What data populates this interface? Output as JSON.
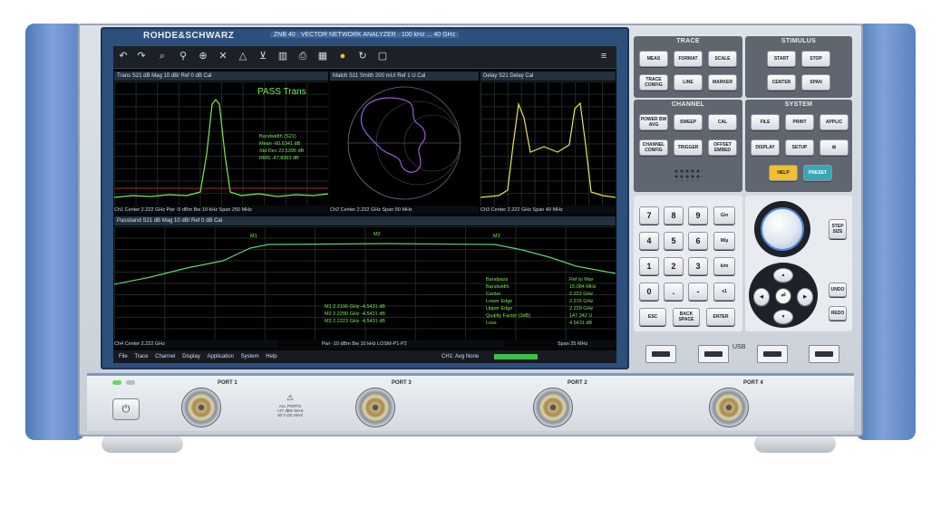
{
  "instrument": {
    "brand": "ROHDE&SCHWARZ",
    "model": "ZNB 40 · VECTOR NETWORK ANALYZER · 100 kHz ... 40 GHz"
  },
  "screen": {
    "toolbar_icons": [
      "undo-icon",
      "redo-icon",
      "zoom-icon",
      "zoom-out-icon",
      "marker-icon",
      "fit-icon",
      "peak-icon",
      "delta-icon",
      "trash-icon",
      "print-icon",
      "windows-icon",
      "help-icon",
      "refresh-icon",
      "display-icon",
      "menu-icon"
    ],
    "trace1": {
      "header": "Trans S21 dB Mag 10 dB/ Ref 0 dB Cal",
      "pass": "PASS Trans",
      "stats": [
        "Bandwidth (S21)",
        "Mean  -60.6341 dB",
        "Std Dev  23.5395 dB",
        "RMS  -47.8363 dB"
      ],
      "footer": "Ch1 Center 2.222 GHz Pwr -5 dBm Bw 10 kHz Span 250 MHz"
    },
    "trace2": {
      "header": "Match S11 Smith 200 mU/ Ref 1 U Cal",
      "footer": "Ch2 Center 2.222 GHz Span 50 MHz"
    },
    "trace3": {
      "header": "Delay S21 Delay Cal",
      "footer": "Ch3 Center 2.222 GHz Span 40 MHz"
    },
    "trace4": {
      "header": "Passband S21 dB Mag 10 dB/ Ref 0 dB Cal",
      "markers": [
        "M1",
        "M2",
        "M3"
      ],
      "readout": [
        "M1 2.2196 GHz -4.5431 dB",
        "M2 2.2290 GHz -4.5431 dB",
        "M3 2.2223 GHz -4.5431 dB"
      ],
      "bw_table": [
        [
          "Bandpass",
          "Ref to Max"
        ],
        [
          "Bandwidth",
          "15.084 MHz"
        ],
        [
          "Center",
          "2.222 GHz"
        ],
        [
          "Lower Edge",
          "2.215 GHz"
        ],
        [
          "Upper Edge",
          "2.229 GHz"
        ],
        [
          "Quality Factor (3dB)",
          "147.342 U"
        ],
        [
          "Loss",
          "4.5431 dB"
        ]
      ],
      "footer_left": "Ch4 Center 2.222 GHz",
      "footer_mid": "Pwr -10 dBm Bw 10 kHz LOSM-P1-P2",
      "footer_right": "Span 25 MHz"
    },
    "menu": [
      "File",
      "Trace",
      "Channel",
      "Display",
      "Application",
      "System",
      "Help"
    ],
    "status": "CH1: Avg None"
  },
  "panels": {
    "trace": {
      "title": "TRACE",
      "keys": [
        "MEAS",
        "FORMAT",
        "SCALE",
        "TRACE CONFIG",
        "LINE",
        "MARKER"
      ]
    },
    "stimulus": {
      "title": "STIMULUS",
      "keys": [
        "START",
        "STOP",
        "CENTER",
        "SPAN"
      ]
    },
    "channel": {
      "title": "CHANNEL",
      "keys": [
        "POWER BW AVG",
        "SWEEP",
        "CAL",
        "CHANNEL CONFIG",
        "TRIGGER",
        "OFFSET EMBED"
      ]
    },
    "system": {
      "title": "SYSTEM",
      "keys": [
        "FILE",
        "PRINT",
        "APPLIC",
        "DISPLAY",
        "SETUP",
        "",
        "HELP",
        "PRESET"
      ]
    },
    "numpad": [
      "7",
      "8",
      "9",
      "G/n",
      "4",
      "5",
      "6",
      "M/µ",
      "1",
      "2",
      "3",
      "k/m",
      "0",
      ".",
      "-",
      "x1",
      "ESC",
      "BACK SPACE",
      "ENTER"
    ],
    "nav_right": [
      "STEP SIZE",
      "UNDO",
      "REDO"
    ],
    "usb_label": "USB"
  },
  "ports": [
    "PORT 1",
    "PORT 3",
    "PORT 2",
    "PORT 4"
  ],
  "warning": [
    "ALL PORTS",
    "+27 dBm MAX",
    "40 V DC MAX"
  ],
  "colors": {
    "trace_green": "#7bea4c",
    "trace_yellow": "#e9e550",
    "smith_purple": "#9a5cd6",
    "chassis_blue": "#5f87c7",
    "help_key": "#f0c030",
    "preset_key": "#3aa7b5"
  }
}
